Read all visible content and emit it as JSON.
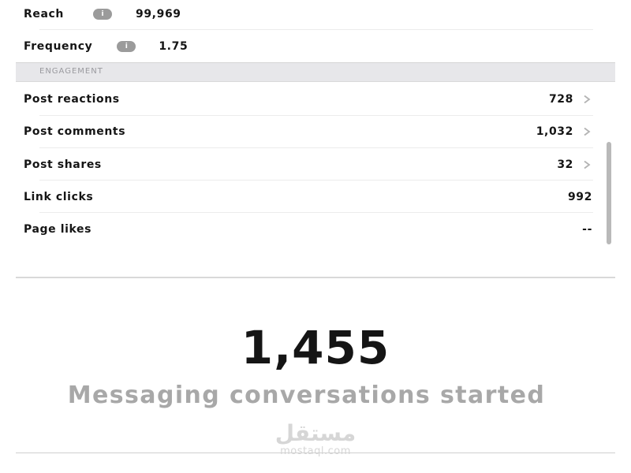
{
  "top_metrics": [
    {
      "label": "Reach",
      "value": "99,969"
    },
    {
      "label": "Frequency",
      "value": "1.75"
    }
  ],
  "info_icon_glyph": "i",
  "engagement": {
    "header": "ENGAGEMENT",
    "rows": [
      {
        "label": "Post reactions",
        "value": "728",
        "has_chevron": true
      },
      {
        "label": "Post comments",
        "value": "1,032",
        "has_chevron": true
      },
      {
        "label": "Post shares",
        "value": "32",
        "has_chevron": true
      },
      {
        "label": "Link clicks",
        "value": "992",
        "has_chevron": false
      },
      {
        "label": "Page likes",
        "value": "--",
        "has_chevron": false
      }
    ]
  },
  "highlight": {
    "number": "1,455",
    "caption": "Messaging conversations started"
  },
  "watermark": {
    "arabic": "مستقل",
    "latin": "mostaql.com"
  },
  "icons": {
    "info": "info-icon",
    "chevron": "chevron-right-icon"
  },
  "colors": {
    "section_header_bg": "#e7e7ea",
    "section_header_text": "#9a9a9f",
    "caption_text": "#a8a8a8",
    "info_pill": "#9b9b9b"
  }
}
